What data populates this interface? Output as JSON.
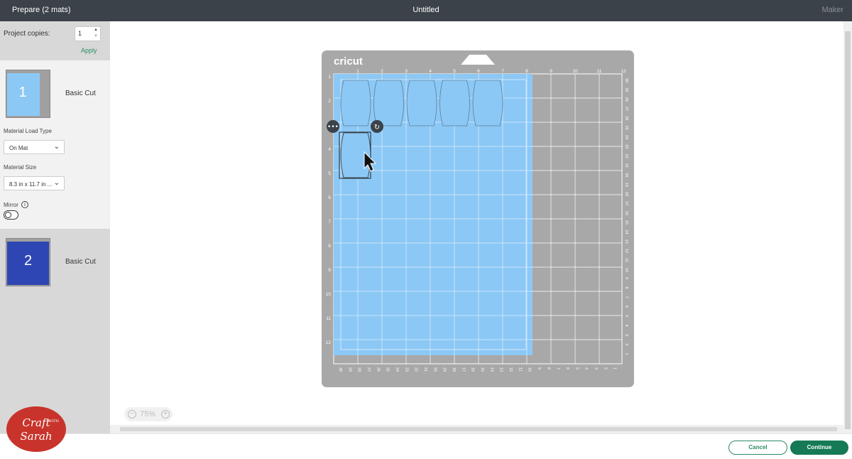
{
  "topbar": {
    "title_left": "Prepare (2 mats)",
    "title_center": "Untitled",
    "title_right": "Maker"
  },
  "sidebar": {
    "project_copies_label": "Project copies:",
    "project_copies_value": "1",
    "apply_label": "Apply",
    "mat1": {
      "number": "1",
      "label": "Basic Cut",
      "material_load_type_label": "Material Load Type",
      "material_load_type_value": "On Mat",
      "material_size_label": "Material Size",
      "material_size_value": "8.3 in x 11.7 in ...",
      "mirror_label": "Mirror",
      "color": "#8cc8f5"
    },
    "mat2": {
      "number": "2",
      "label": "Basic Cut",
      "color": "#2e46b3"
    }
  },
  "mat": {
    "brand": "cricut",
    "top_ruler": [
      "1",
      "2",
      "3",
      "4",
      "5",
      "6",
      "7",
      "8",
      "9",
      "10",
      "11",
      "12"
    ],
    "left_ruler": [
      "1",
      "2",
      "3",
      "4",
      "5",
      "6",
      "7",
      "8",
      "9",
      "10",
      "11",
      "12"
    ],
    "bottom_ruler": [
      "30",
      "29",
      "28",
      "27",
      "26",
      "25",
      "24",
      "23",
      "22",
      "21",
      "20",
      "19",
      "18",
      "17",
      "16",
      "15",
      "14",
      "13",
      "12",
      "11",
      "10",
      "9",
      "8",
      "7",
      "6",
      "5",
      "4",
      "3",
      "2",
      "1"
    ],
    "right_ruler": [
      "30",
      "29",
      "28",
      "27",
      "26",
      "25",
      "24",
      "23",
      "22",
      "21",
      "20",
      "19",
      "18",
      "17",
      "16",
      "15",
      "14",
      "13",
      "12",
      "11",
      "10",
      "9",
      "8",
      "7",
      "6",
      "5",
      "4",
      "3",
      "2",
      "1"
    ],
    "mat_color": "#a8a8a8",
    "material_color": "#8cc8f5"
  },
  "zoom": {
    "value": "75%"
  },
  "buttons": {
    "cancel": "Cancel",
    "continue": "Continue"
  },
  "watermark": {
    "line1": "Craft",
    "with": "WITH",
    "line2": "Sarah"
  }
}
